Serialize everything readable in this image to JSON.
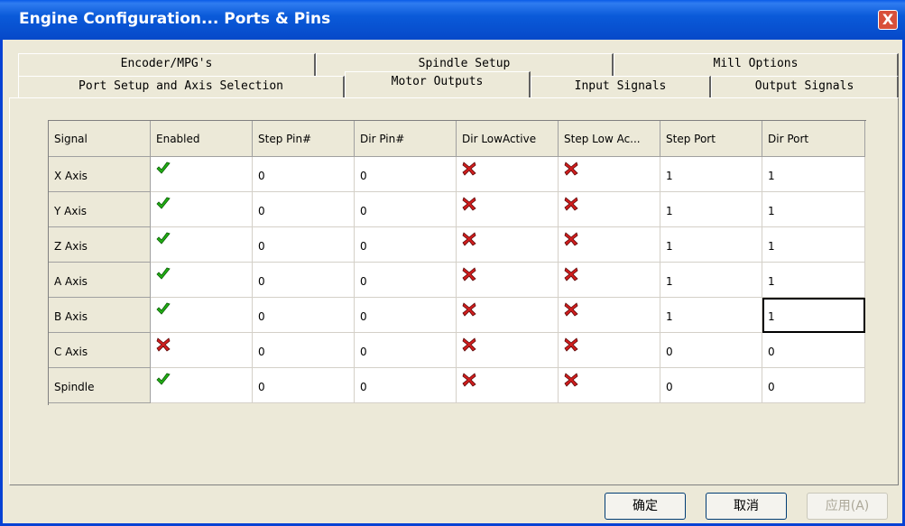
{
  "window": {
    "title": "Engine Configuration... Ports & Pins",
    "close_label": "X"
  },
  "tabs_back": [
    "Encoder/MPG's",
    "Spindle Setup",
    "Mill Options"
  ],
  "tabs_front": [
    "Port Setup and Axis Selection",
    "Motor Outputs",
    "Input Signals",
    "Output Signals"
  ],
  "active_tab": "Motor Outputs",
  "table": {
    "columns": [
      "Signal",
      "Enabled",
      "Step Pin#",
      "Dir Pin#",
      "Dir LowActive",
      "Step Low Ac...",
      "Step Port",
      "Dir Port"
    ],
    "rows": [
      {
        "signal": "X Axis",
        "enabled": true,
        "step_pin": "0",
        "dir_pin": "0",
        "dir_low_active": false,
        "step_low_active": false,
        "step_port": "1",
        "dir_port": "1"
      },
      {
        "signal": "Y Axis",
        "enabled": true,
        "step_pin": "0",
        "dir_pin": "0",
        "dir_low_active": false,
        "step_low_active": false,
        "step_port": "1",
        "dir_port": "1"
      },
      {
        "signal": "Z Axis",
        "enabled": true,
        "step_pin": "0",
        "dir_pin": "0",
        "dir_low_active": false,
        "step_low_active": false,
        "step_port": "1",
        "dir_port": "1"
      },
      {
        "signal": "A Axis",
        "enabled": true,
        "step_pin": "0",
        "dir_pin": "0",
        "dir_low_active": false,
        "step_low_active": false,
        "step_port": "1",
        "dir_port": "1"
      },
      {
        "signal": "B Axis",
        "enabled": true,
        "step_pin": "0",
        "dir_pin": "0",
        "dir_low_active": false,
        "step_low_active": false,
        "step_port": "1",
        "dir_port": "1"
      },
      {
        "signal": "C Axis",
        "enabled": false,
        "step_pin": "0",
        "dir_pin": "0",
        "dir_low_active": false,
        "step_low_active": false,
        "step_port": "0",
        "dir_port": "0"
      },
      {
        "signal": "Spindle",
        "enabled": true,
        "step_pin": "0",
        "dir_pin": "0",
        "dir_low_active": false,
        "step_low_active": false,
        "step_port": "0",
        "dir_port": "0"
      }
    ],
    "selected_cell": {
      "row": "B Axis",
      "column": "Dir Port"
    }
  },
  "buttons": {
    "ok": "确定",
    "cancel": "取消",
    "apply": "应用(A)"
  },
  "colors": {
    "titlebar": "#0a5ad9",
    "check": "#22b014",
    "cross": "#d21e1e",
    "dialog_bg": "#ece9d8"
  },
  "icons": {
    "enabled_true": "green-check-icon",
    "enabled_false": "red-x-icon"
  }
}
